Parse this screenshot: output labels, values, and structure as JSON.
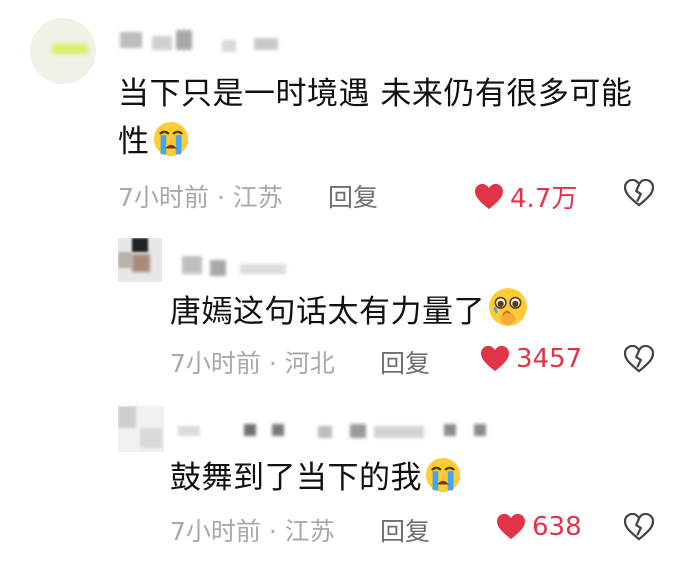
{
  "colors": {
    "like": "#e33349",
    "meta": "#a9a9a9",
    "reply": "#6f6f6f",
    "text": "#111111"
  },
  "comments": [
    {
      "text_line1": "当下只是一时境遇 未来仍有很多可能",
      "text_line2": "性",
      "emoji": "loudly-crying-face",
      "meta": "7小时前 · 江苏",
      "reply": "回复",
      "likes": "4.7万"
    },
    {
      "text_line1": "唐嫣这句话太有力量了",
      "emoji": "face-holding-back-tears",
      "meta": "7小时前 · 河北",
      "reply": "回复",
      "likes": "3457"
    },
    {
      "text_line1": "鼓舞到了当下的我",
      "emoji": "loudly-crying-face",
      "meta": "7小时前 · 江苏",
      "reply": "回复",
      "likes": "638"
    }
  ]
}
